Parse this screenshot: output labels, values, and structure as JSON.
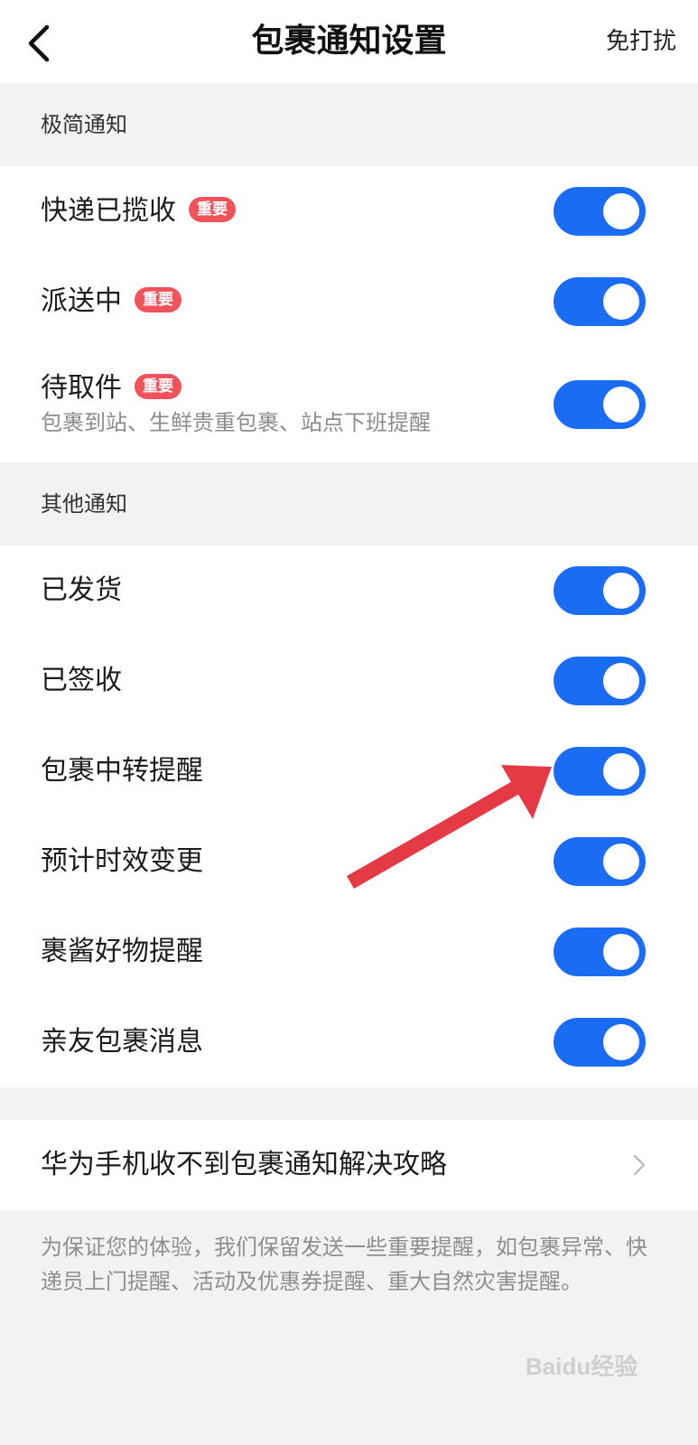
{
  "header": {
    "title": "包裹通知设置",
    "action_label": "免打扰",
    "back_icon": "chevron-left-icon"
  },
  "sections": [
    {
      "title": "极简通知",
      "items": [
        {
          "label": "快递已揽收",
          "badge": "重要",
          "enabled": true
        },
        {
          "label": "派送中",
          "badge": "重要",
          "enabled": true
        },
        {
          "label": "待取件",
          "badge": "重要",
          "subtitle": "包裹到站、生鲜贵重包裹、站点下班提醒",
          "enabled": true
        }
      ]
    },
    {
      "title": "其他通知",
      "items": [
        {
          "label": "已发货",
          "enabled": true
        },
        {
          "label": "已签收",
          "enabled": true
        },
        {
          "label": "包裹中转提醒",
          "enabled": true
        },
        {
          "label": "预计时效变更",
          "enabled": true
        },
        {
          "label": "裹酱好物提醒",
          "enabled": true
        },
        {
          "label": "亲友包裹消息",
          "enabled": true
        }
      ]
    }
  ],
  "help_link": {
    "label": "华为手机收不到包裹通知解决攻略",
    "icon": "chevron-right-icon"
  },
  "footer_note": "为保证您的体验，我们保留发送一些重要提醒，如包裹异常、快递员上门提醒、活动及优惠券提醒、重大自然灾害提醒。",
  "watermark": "Baidu经验",
  "colors": {
    "toggle_on": "#1b6cf5",
    "badge": "#f2525a",
    "annotation_arrow": "#e63946",
    "page_bg": "#f2f2f4"
  }
}
